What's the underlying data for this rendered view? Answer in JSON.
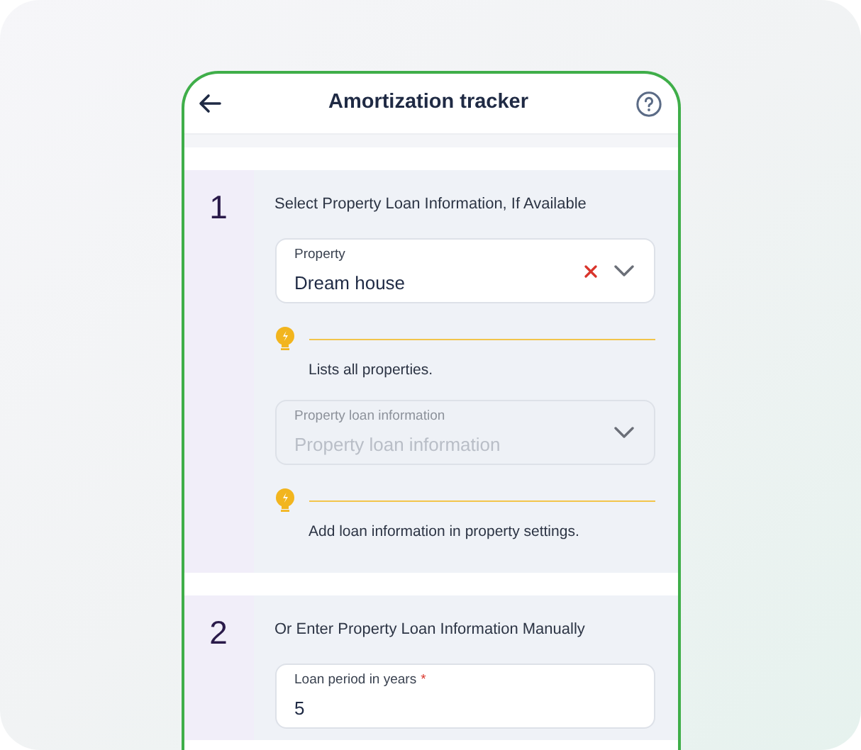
{
  "header": {
    "title": "Amortization tracker"
  },
  "steps": [
    {
      "number": "1",
      "title": "Select Property Loan Information, If Available",
      "items": [
        {
          "kind": "select",
          "label": "Property",
          "value": "Dream house",
          "clearable": true,
          "disabled": false
        },
        {
          "kind": "hint",
          "text": "Lists all properties."
        },
        {
          "kind": "select",
          "label": "Property loan information",
          "placeholder": "Property loan information",
          "clearable": false,
          "disabled": true
        },
        {
          "kind": "hint",
          "text": "Add loan information in property settings."
        }
      ]
    },
    {
      "number": "2",
      "title": "Or Enter Property Loan Information Manually",
      "items": [
        {
          "kind": "text",
          "label": "Loan period in years",
          "required_mark": "*",
          "value": "5"
        }
      ]
    }
  ]
}
